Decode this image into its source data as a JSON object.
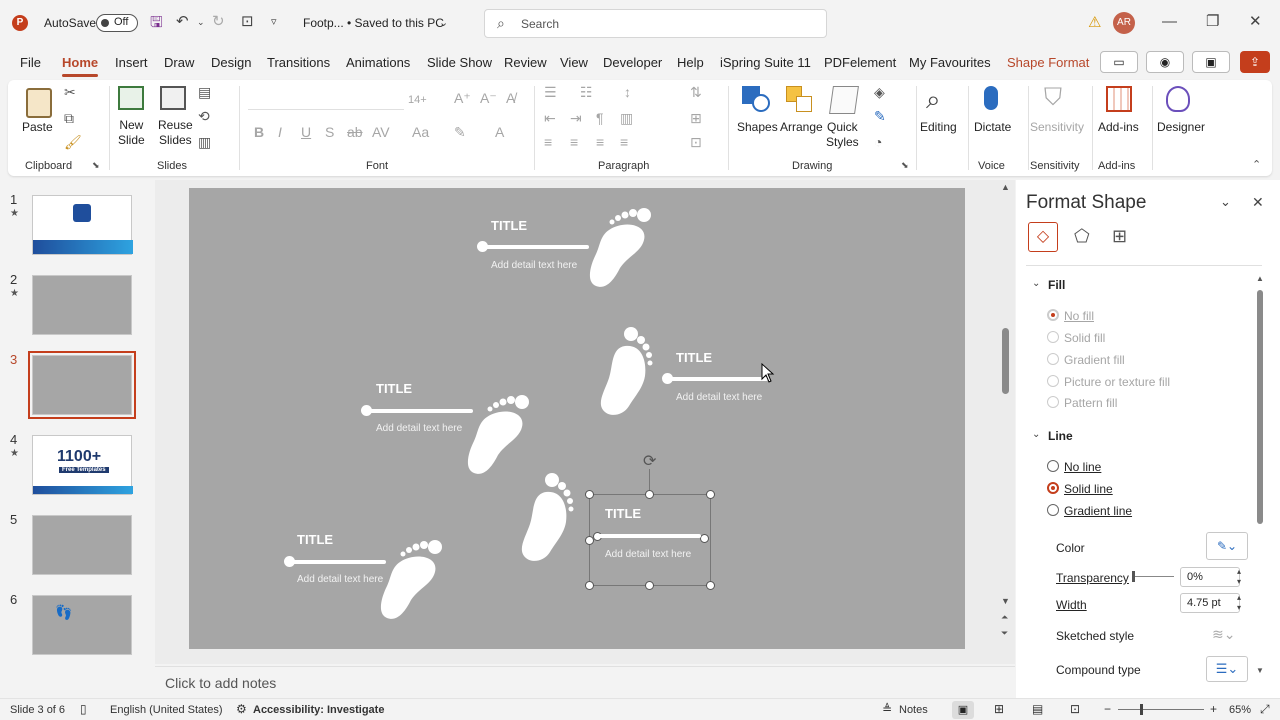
{
  "titlebar": {
    "autosave_label": "AutoSave",
    "autosave_state": "Off",
    "doc_title": "Footp... • Saved to this PC",
    "search_placeholder": "Search",
    "avatar_initials": "AR"
  },
  "menu": {
    "tabs": [
      "File",
      "Home",
      "Insert",
      "Draw",
      "Design",
      "Transitions",
      "Animations",
      "Slide Show",
      "Review",
      "View",
      "Developer",
      "Help",
      "iSpring Suite 11",
      "PDFelement",
      "My Favourites",
      "Shape Format"
    ],
    "active": "Home"
  },
  "ribbon": {
    "paste": "Paste",
    "new_slide": [
      "New",
      "Slide"
    ],
    "reuse_slides": [
      "Reuse",
      "Slides"
    ],
    "font_size": "14+",
    "shapes": "Shapes",
    "arrange": "Arrange",
    "quick_styles": [
      "Quick",
      "Styles"
    ],
    "editing": "Editing",
    "dictate": "Dictate",
    "sensitivity": "Sensitivity",
    "addins": "Add-ins",
    "designer": "Designer",
    "groups": {
      "clipboard": "Clipboard",
      "slides": "Slides",
      "font": "Font",
      "paragraph": "Paragraph",
      "drawing": "Drawing",
      "voice": "Voice",
      "sensitivity": "Sensitivity",
      "addins": "Add-ins"
    }
  },
  "thumbnails": [
    {
      "num": "1",
      "star": "★"
    },
    {
      "num": "2",
      "star": "★"
    },
    {
      "num": "3",
      "star": ""
    },
    {
      "num": "4",
      "star": "★"
    },
    {
      "num": "5",
      "star": ""
    },
    {
      "num": "6",
      "star": ""
    }
  ],
  "thumb4_text": "1100+",
  "thumb4_sub": "Free Templates",
  "slide": {
    "items": [
      {
        "title": "TITLE",
        "detail": "Add detail text here"
      },
      {
        "title": "TITLE",
        "detail": "Add detail text here"
      },
      {
        "title": "TITLE",
        "detail": "Add detail text here"
      },
      {
        "title": "TITLE",
        "detail": "Add detail text here"
      },
      {
        "title": "TITLE",
        "detail": "Add detail text here"
      }
    ]
  },
  "notes_placeholder": "Click to add notes",
  "pane": {
    "title": "Format Shape",
    "fill_header": "Fill",
    "fill_options": [
      "No fill",
      "Solid fill",
      "Gradient fill",
      "Picture or texture fill",
      "Pattern fill"
    ],
    "line_header": "Line",
    "line_options": [
      "No line",
      "Solid line",
      "Gradient line"
    ],
    "color_label": "Color",
    "transparency_label": "Transparency",
    "transparency_value": "0%",
    "width_label": "Width",
    "width_value": "4.75 pt",
    "sketched_label": "Sketched style",
    "compound_label": "Compound type"
  },
  "status": {
    "slide_info": "Slide 3 of 6",
    "language": "English (United States)",
    "accessibility": "Accessibility: Investigate",
    "notes": "Notes",
    "zoom": "65%"
  },
  "colors": {
    "accent": "#b7472a",
    "slide_bg": "#a6a6a6"
  }
}
